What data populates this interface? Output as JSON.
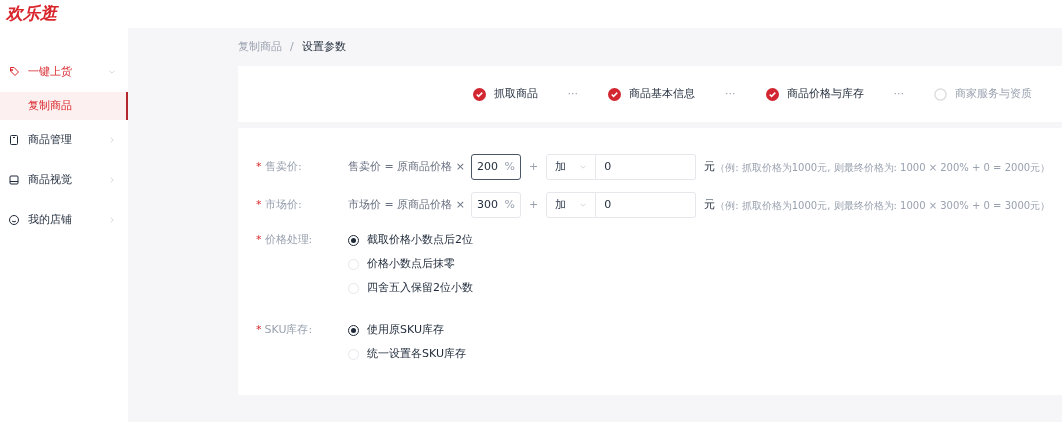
{
  "logo": "欢乐逛",
  "sidebar": {
    "items": [
      {
        "label": "一键上货",
        "kind": "tag",
        "expanded": true,
        "children": [
          {
            "label": "复制商品",
            "selected": true
          }
        ]
      },
      {
        "label": "商品管理",
        "kind": "bag",
        "expanded": false
      },
      {
        "label": "商品视觉",
        "kind": "monitor",
        "expanded": false
      },
      {
        "label": "我的店铺",
        "kind": "smile",
        "expanded": false
      }
    ]
  },
  "breadcrumb": [
    "复制商品",
    "/",
    "设置参数"
  ],
  "steps": [
    {
      "label": "抓取商品",
      "done": true
    },
    {
      "label": "商品基本信息",
      "done": true
    },
    {
      "label": "商品价格与库存",
      "done": true
    },
    {
      "label": "商家服务与资质",
      "done": false
    }
  ],
  "step_separator": "···",
  "price_rows": [
    {
      "label": "售卖价:",
      "formula": "售卖价 = 原商品价格 ×",
      "percent": "200",
      "focused": true,
      "percent_sign": "%",
      "plus": "+",
      "op": "加",
      "amount": "0",
      "unit": "元",
      "example": "（例: 抓取价格为1000元, 则最终价格为: 1000 × 200% + 0 = 2000元）"
    },
    {
      "label": "市场价:",
      "formula": "市场价 = 原商品价格 ×",
      "percent": "300",
      "focused": false,
      "percent_sign": "%",
      "plus": "+",
      "op": "加",
      "amount": "0",
      "unit": "元",
      "example": "（例: 抓取价格为1000元, 则最终价格为: 1000 × 300% + 0 = 3000元）"
    }
  ],
  "radio_groups": [
    {
      "label": "价格处理:",
      "options": [
        {
          "label": "截取价格小数点后2位",
          "selected": true
        },
        {
          "label": "价格小数点后抹零",
          "selected": false
        },
        {
          "label": "四舍五入保留2位小数",
          "selected": false
        }
      ]
    },
    {
      "label": "SKU库存:",
      "options": [
        {
          "label": "使用原SKU库存",
          "selected": true
        },
        {
          "label": "统一设置各SKU库存",
          "selected": false
        }
      ]
    }
  ],
  "required_mark": "*"
}
